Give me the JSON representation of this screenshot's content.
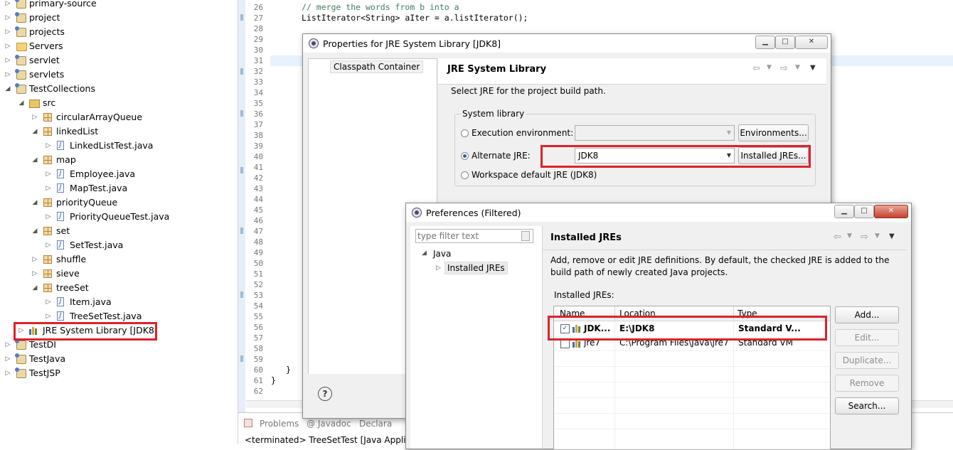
{
  "explorer": {
    "items": [
      {
        "label": "primary-source",
        "icon": "project-icon"
      },
      {
        "label": "project",
        "icon": "project-icon"
      },
      {
        "label": "projects",
        "icon": "project-icon"
      },
      {
        "label": "Servers",
        "icon": "folder-icon"
      },
      {
        "label": "servlet",
        "icon": "project-icon"
      },
      {
        "label": "servlets",
        "icon": "project-icon"
      },
      {
        "label": "TestCollections",
        "icon": "project-icon"
      },
      {
        "label": "src",
        "icon": "source-folder-icon"
      },
      {
        "label": "circularArrayQueue",
        "icon": "package-icon"
      },
      {
        "label": "linkedList",
        "icon": "package-icon"
      },
      {
        "label": "LinkedListTest.java",
        "icon": "java-file-icon"
      },
      {
        "label": "map",
        "icon": "package-icon"
      },
      {
        "label": "Employee.java",
        "icon": "java-file-icon"
      },
      {
        "label": "MapTest.java",
        "icon": "java-file-icon"
      },
      {
        "label": "priorityQueue",
        "icon": "package-icon"
      },
      {
        "label": "PriorityQueueTest.java",
        "icon": "java-file-icon"
      },
      {
        "label": "set",
        "icon": "package-icon"
      },
      {
        "label": "SetTest.java",
        "icon": "java-file-icon"
      },
      {
        "label": "shuffle",
        "icon": "package-icon"
      },
      {
        "label": "sieve",
        "icon": "package-icon"
      },
      {
        "label": "treeSet",
        "icon": "package-icon"
      },
      {
        "label": "Item.java",
        "icon": "java-file-icon"
      },
      {
        "label": "TreeSetTest.java",
        "icon": "java-file-icon"
      },
      {
        "label": "JRE System Library [JDK8]",
        "icon": "library-icon"
      },
      {
        "label": "TestDI",
        "icon": "project-icon"
      },
      {
        "label": "TestJava",
        "icon": "project-icon"
      },
      {
        "label": "TestJSP",
        "icon": "project-icon"
      }
    ]
  },
  "editor": {
    "line_numbers": [
      "26",
      "27",
      "28",
      "29",
      "30",
      "31",
      "32",
      "33",
      "34",
      "35",
      "36",
      "37",
      "38",
      "39",
      "40",
      "41",
      "42",
      "43",
      "44",
      "45",
      "46",
      "47",
      "48",
      "49",
      "50",
      "51",
      "52",
      "53",
      "54",
      "55",
      "56",
      "57",
      "58",
      "59",
      "60",
      "61",
      "62"
    ],
    "code_comment": "// merge the words from b into a",
    "code_line27": "ListIterator<String> aIter = a.listIterator();",
    "code_line60": "}",
    "code_line61": "}"
  },
  "bottom_panel": {
    "tabs": [
      "Problems",
      "@ Javadoc",
      "Declara"
    ],
    "console_status": "<terminated> TreeSetTest [Java Appli"
  },
  "properties_dialog": {
    "title": "Properties for JRE System Library [JDK8]",
    "sidebar_item": "Classpath Container",
    "page_title": "JRE System Library",
    "description": "Select JRE for the project build path.",
    "group_label": "System library",
    "option_execution_env": "Execution environment:",
    "option_alternate_jre": "Alternate JRE:",
    "option_workspace_default": "Workspace default JRE (JDK8)",
    "selected_option": "alternate",
    "alternate_jre_value": "JDK8",
    "environments_button": "Environments...",
    "installed_jres_button": "Installed JREs...",
    "help_icon": "?"
  },
  "preferences_dialog": {
    "title": "Preferences (Filtered)",
    "filter_placeholder": "type filter text",
    "tree_root": "Java",
    "tree_child": "Installed JREs",
    "page_title": "Installed JREs",
    "description": "Add, remove or edit JRE definitions. By default, the checked JRE is added to the build path of newly created Java projects.",
    "list_label": "Installed JREs:",
    "columns": [
      "Name",
      "Location",
      "Type"
    ],
    "rows": [
      {
        "checked": true,
        "name": "JDK...",
        "location": "E:\\JDK8",
        "type": "Standard V..."
      },
      {
        "checked": false,
        "name": "jre7",
        "location": "C:\\Program Files\\Java\\jre7",
        "type": "Standard VM"
      }
    ],
    "buttons": {
      "add": "Add...",
      "edit": "Edit...",
      "duplicate": "Duplicate...",
      "remove": "Remove",
      "search": "Search..."
    }
  },
  "colors": {
    "highlight_red": "#e0202a",
    "comment_green": "#3f7f5f",
    "selection_blue": "#e8f2fe"
  }
}
